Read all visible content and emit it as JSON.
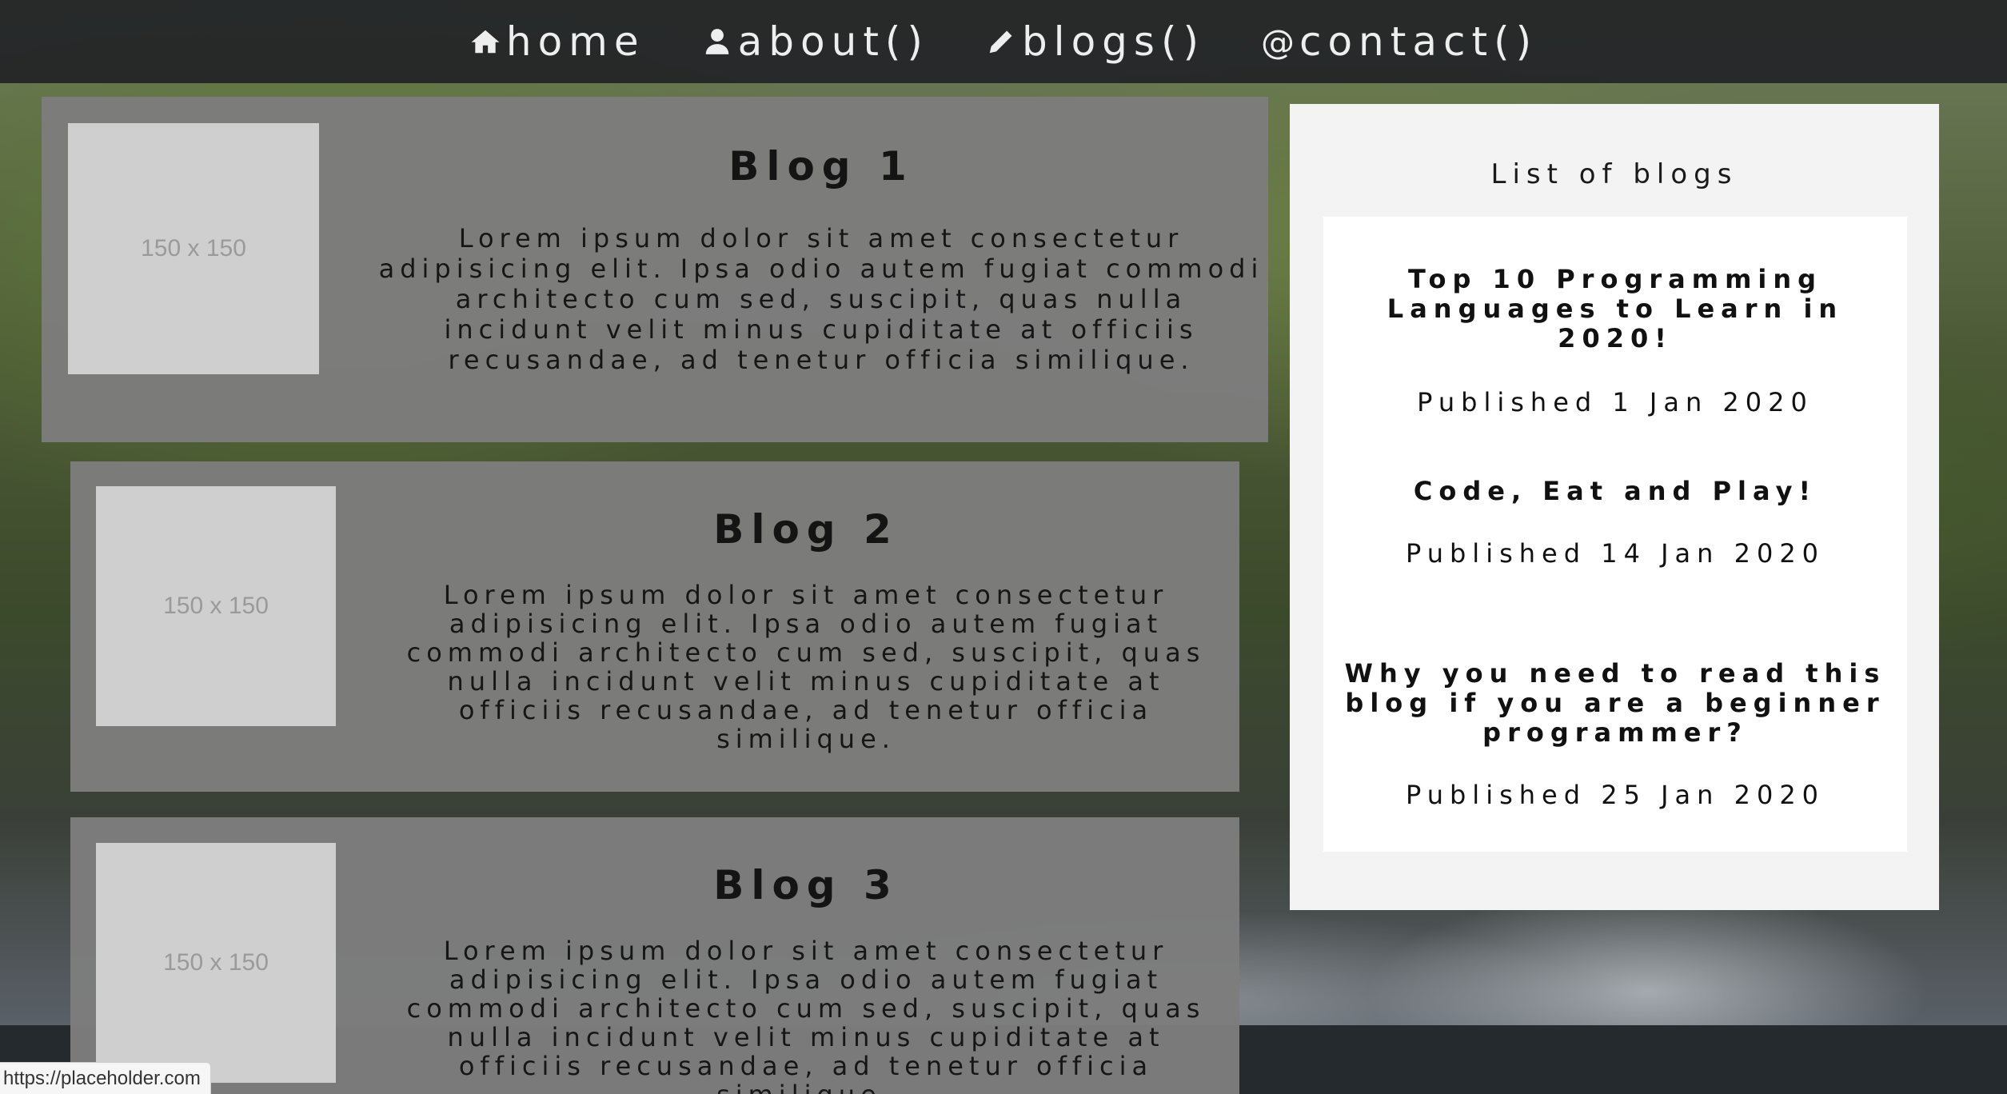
{
  "nav": {
    "items": [
      {
        "label": "home",
        "icon": "home-icon"
      },
      {
        "label": "about()",
        "icon": "user-icon"
      },
      {
        "label": "blogs()",
        "icon": "pencil-icon"
      },
      {
        "label": "contact()",
        "icon": "at-icon",
        "glyph": "@"
      }
    ]
  },
  "blogs": [
    {
      "title": "Blog 1",
      "thumbnail_label": "150 x 150",
      "text": "Lorem ipsum dolor sit amet consectetur adipisicing elit. Ipsa odio autem fugiat commodi architecto cum sed, suscipit, quas nulla incidunt velit minus cupiditate at officiis recusandae, ad tenetur officia similique."
    },
    {
      "title": "Blog 2",
      "thumbnail_label": "150 x 150",
      "text": "Lorem ipsum dolor sit amet consectetur adipisicing elit. Ipsa odio autem fugiat commodi architecto cum sed, suscipit, quas nulla incidunt velit minus cupiditate at officiis recusandae, ad tenetur officia similique."
    },
    {
      "title": "Blog 3",
      "thumbnail_label": "150 x 150",
      "text": "Lorem ipsum dolor sit amet consectetur adipisicing elit. Ipsa odio autem fugiat commodi architecto cum sed, suscipit, quas nulla incidunt velit minus cupiditate at officiis recusandae, ad tenetur officia similique."
    }
  ],
  "sidebar": {
    "heading": "List of blogs",
    "entries": [
      {
        "title": "Top 10 Programming Languages to Learn in 2020!",
        "date": "Published 1 Jan 2020"
      },
      {
        "title": "Code, Eat and Play!",
        "date": "Published 14 Jan 2020"
      },
      {
        "title": "Why you need to read this blog if you are a beginner programmer?",
        "date": "Published 25 Jan 2020"
      }
    ]
  },
  "status_bar": {
    "url": "https://placeholder.com"
  },
  "colors": {
    "navbar": "#222427",
    "card": "#7d7d7d",
    "sidebar": "#f3f3f3",
    "thumbnail": "#cfcfcf"
  }
}
